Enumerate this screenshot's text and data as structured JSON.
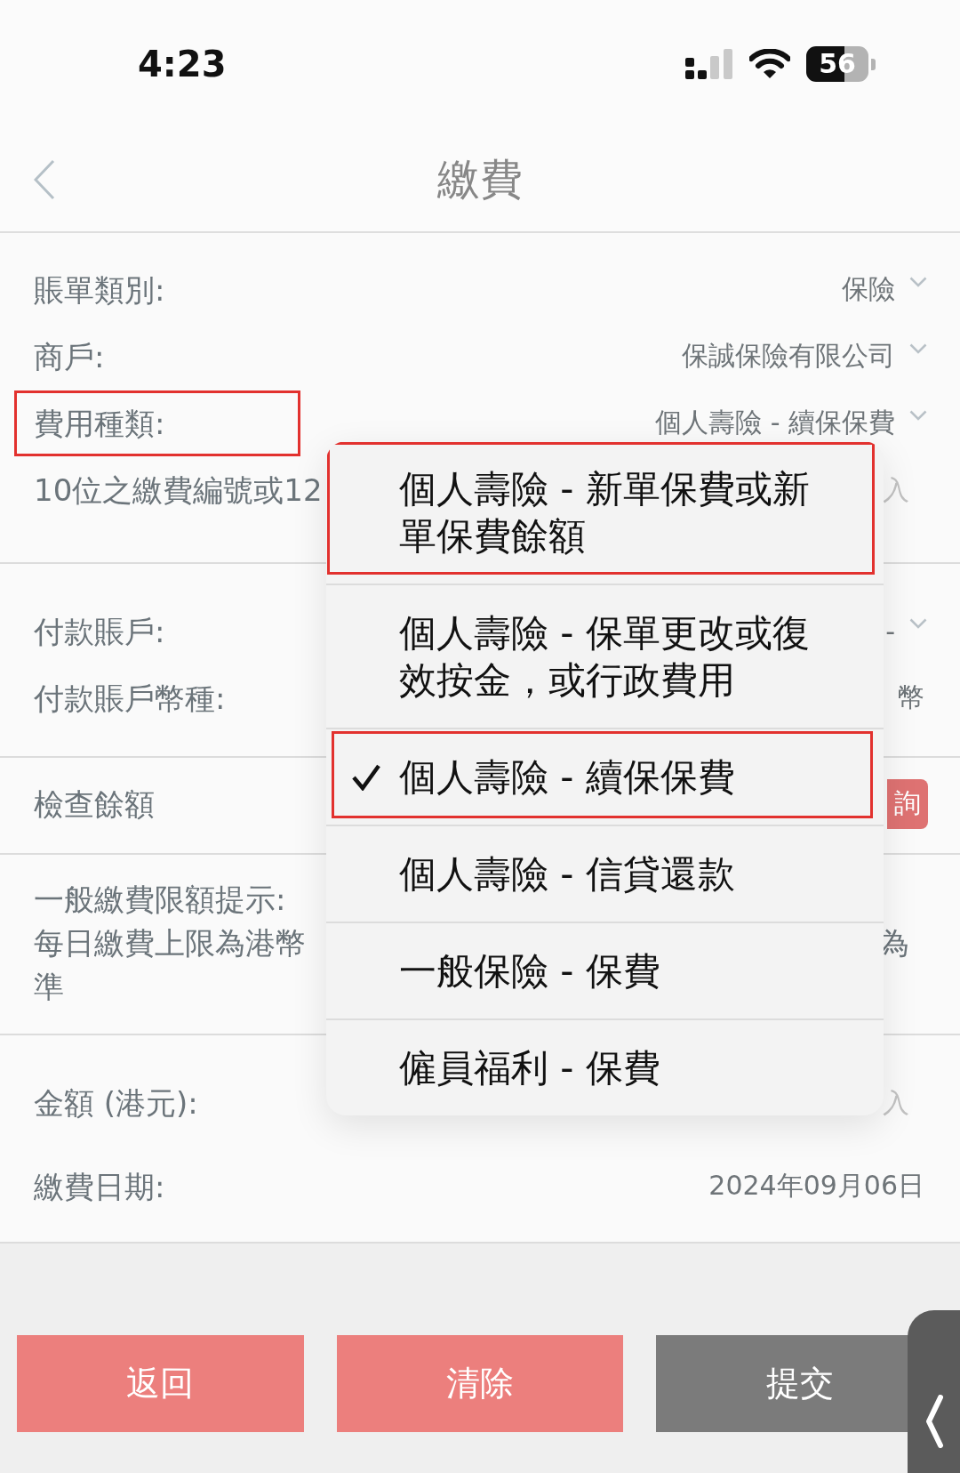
{
  "status_bar": {
    "time": "4:23",
    "battery": "56"
  },
  "nav": {
    "title": "繳費"
  },
  "sections": [
    {
      "rows": [
        {
          "kind": "select",
          "label": "賬單類別:",
          "value": "保險",
          "annotated": false
        },
        {
          "kind": "select",
          "label": "商戶:",
          "value": "保誠保險有限公司",
          "annotated": false
        },
        {
          "kind": "select",
          "label": "費用種類:",
          "value": "個人壽險 - 續保保費",
          "annotated": true
        },
        {
          "kind": "input",
          "label": "10位之繳費編號或12",
          "placeholder": "入",
          "annotated": false
        }
      ]
    },
    {
      "rows": [
        {
          "kind": "select",
          "label": "付款賬戶:",
          "value": "-",
          "annotated": false
        },
        {
          "kind": "text",
          "label": "付款賬戶幣種:",
          "value": "幣",
          "annotated": false
        }
      ]
    },
    {
      "rows": [
        {
          "kind": "action",
          "label": "檢查餘額",
          "button": "詢",
          "annotated": false
        }
      ]
    },
    {
      "rows": [
        {
          "kind": "note",
          "label": "一般繳費限額提示:",
          "lines": [
            {
              "left": "每日繳費上限為港幣",
              "right": "為"
            },
            {
              "left": "準"
            }
          ],
          "annotated": false
        }
      ]
    },
    {
      "rows": [
        {
          "kind": "input",
          "label": "金額 (港元):",
          "placeholder": "入",
          "annotated": false
        },
        {
          "kind": "text",
          "label": "繳費日期:",
          "value": "2024年09月06日",
          "annotated": false
        }
      ]
    }
  ],
  "buttons": [
    {
      "label": "返回",
      "kind": "primary"
    },
    {
      "label": "清除",
      "kind": "primary"
    },
    {
      "label": "提交",
      "kind": "secondary"
    }
  ],
  "dropdown": {
    "options": [
      {
        "label": "個人壽險 - 新單保費或新單保費餘額",
        "selected": false,
        "annotated": true
      },
      {
        "label": "個人壽險 - 保單更改或復效按金，或行政費用",
        "selected": false,
        "annotated": false
      },
      {
        "label": "個人壽險 - 續保保費",
        "selected": true,
        "annotated": true
      },
      {
        "label": "個人壽險 - 信貸還款",
        "selected": false,
        "annotated": false
      },
      {
        "label": "一般保險 - 保費",
        "selected": false,
        "annotated": false
      },
      {
        "label": "僱員福利 - 保費",
        "selected": false,
        "annotated": false
      }
    ]
  }
}
